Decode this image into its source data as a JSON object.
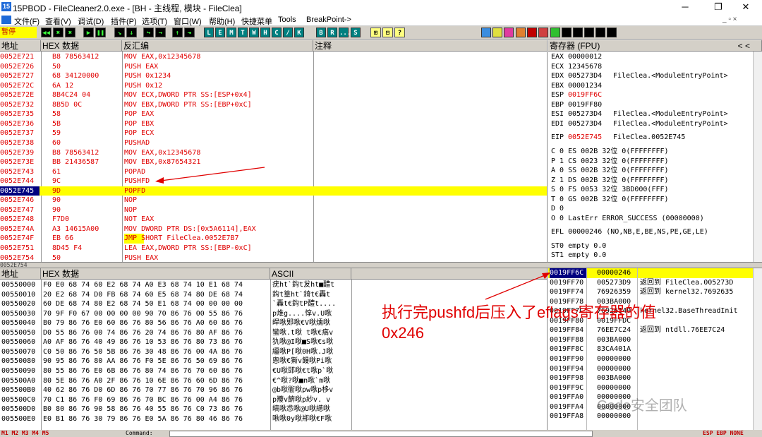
{
  "titlebar": {
    "app_icon_text": "15",
    "title": "15PBOD - FileCleaner2.0.exe - [BH - 主线程, 模块 - FileClea]",
    "minimize": "─",
    "maximize": "❐",
    "close": "✕"
  },
  "menubar": {
    "items": [
      "文件(F)",
      "查看(V)",
      "调试(D)",
      "插件(P)",
      "选项(T)",
      "窗口(W)",
      "帮助(H)",
      "快捷菜单",
      "Tools",
      "BreakPoint->"
    ],
    "mdi_controls": "_ ▫ ×"
  },
  "toolbar": {
    "state": "暂停",
    "debug_buttons": [
      "◀◀",
      "✖",
      "▶",
      "❚❚",
      "↘",
      "↓",
      "↪",
      "→",
      "↑",
      "⇥"
    ],
    "letter_buttons": [
      "L",
      "E",
      "M",
      "T",
      "W",
      "H",
      "C",
      "/",
      "K",
      "B",
      "R",
      "...",
      "S"
    ],
    "right_icons": [
      "⊞",
      "⊟",
      "?"
    ]
  },
  "disasm": {
    "headers": {
      "addr": "地址",
      "hex": "HEX 数据",
      "disasm": "反汇编",
      "comment": "注释"
    },
    "rows": [
      {
        "addr": "0052E721",
        "hex": "B8 78563412",
        "asm": "MOV EAX,0x12345678",
        "hl": false,
        "arrow": false
      },
      {
        "addr": "0052E726",
        "hex": "50",
        "asm": "PUSH EAX",
        "hl": false,
        "arrow": false
      },
      {
        "addr": "0052E727",
        "hex": "68 34120000",
        "asm": "PUSH 0x1234",
        "hl": false,
        "arrow": false
      },
      {
        "addr": "0052E72C",
        "hex": "6A 12",
        "asm": "PUSH 0x12",
        "hl": false,
        "arrow": false
      },
      {
        "addr": "0052E72E",
        "hex": "8B4C24 04",
        "asm": "MOV ECX,DWORD PTR SS:[ESP+0x4]",
        "hl": false,
        "arrow": false
      },
      {
        "addr": "0052E732",
        "hex": "8B5D 0C",
        "asm": "MOV EBX,DWORD PTR SS:[EBP+0xC]",
        "hl": false,
        "arrow": false
      },
      {
        "addr": "0052E735",
        "hex": "58",
        "asm": "POP EAX",
        "hl": false,
        "arrow": false
      },
      {
        "addr": "0052E736",
        "hex": "5B",
        "asm": "POP EBX",
        "hl": false,
        "arrow": false
      },
      {
        "addr": "0052E737",
        "hex": "59",
        "asm": "POP ECX",
        "hl": false,
        "arrow": false
      },
      {
        "addr": "0052E738",
        "hex": "60",
        "asm": "PUSHAD",
        "hl": false,
        "arrow": false
      },
      {
        "addr": "0052E739",
        "hex": "B8 78563412",
        "asm": "MOV EAX,0x12345678",
        "hl": false,
        "arrow": false
      },
      {
        "addr": "0052E73E",
        "hex": "BB 21436587",
        "asm": "MOV EBX,0x87654321",
        "hl": false,
        "arrow": false
      },
      {
        "addr": "0052E743",
        "hex": "61",
        "asm": "POPAD",
        "hl": false,
        "arrow": false
      },
      {
        "addr": "0052E744",
        "hex": "9C",
        "asm": "PUSHFD",
        "hl": false,
        "arrow": true
      },
      {
        "addr": "0052E745",
        "hex": "9D",
        "asm": "POPFD",
        "hl": true,
        "arrow": false
      },
      {
        "addr": "0052E746",
        "hex": "90",
        "asm": "NOP",
        "hl": false,
        "arrow": false
      },
      {
        "addr": "0052E747",
        "hex": "90",
        "asm": "NOP",
        "hl": false,
        "arrow": false
      },
      {
        "addr": "0052E748",
        "hex": "F7D0",
        "asm": "NOT EAX",
        "hl": false,
        "arrow": false
      },
      {
        "addr": "0052E74A",
        "hex": "A3 14615A00",
        "asm": "MOV DWORD PTR DS:[0x5A6114],EAX",
        "hl": false,
        "arrow": false
      },
      {
        "addr": "0052E74F",
        "hex": "EB 66",
        "asm": "JMP SHORT FileClea.0052E7B7",
        "hl": false,
        "arrow": false,
        "jmp": true
      },
      {
        "addr": "0052E751",
        "hex": "8D45 F4",
        "asm": "LEA EAX,DWORD PTR SS:[EBP-0xC]",
        "hl": false,
        "arrow": false
      },
      {
        "addr": "0052E754",
        "hex": "50",
        "asm": "PUSH EAX",
        "hl": false,
        "arrow": false
      }
    ]
  },
  "registers": {
    "header": "寄存器 (FPU)",
    "header_arrows": "<   <",
    "lines": [
      {
        "name": "EAX",
        "val": "00000012",
        "note": "",
        "red": false
      },
      {
        "name": "ECX",
        "val": "12345678",
        "note": "",
        "red": false
      },
      {
        "name": "EDX",
        "val": "005273D4",
        "note": "FileClea.<ModuleEntryPoint>",
        "red": false
      },
      {
        "name": "EBX",
        "val": "00001234",
        "note": "",
        "red": false
      },
      {
        "name": "ESP",
        "val": "0019FF6C",
        "note": "",
        "red": true
      },
      {
        "name": "EBP",
        "val": "0019FF80",
        "note": "",
        "red": false
      },
      {
        "name": "ESI",
        "val": "005273D4",
        "note": "FileClea.<ModuleEntryPoint>",
        "red": false
      },
      {
        "name": "EDI",
        "val": "005273D4",
        "note": "FileClea.<ModuleEntryPoint>",
        "red": false
      }
    ],
    "eip": {
      "name": "EIP",
      "val": "0052E745",
      "note": "FileClea.0052E745"
    },
    "flags": [
      "C 0  ES 002B 32位 0(FFFFFFFF)",
      "P 1  CS 0023 32位 0(FFFFFFFF)",
      "A 0  SS 002B 32位 0(FFFFFFFF)",
      "Z 1  DS 002B 32位 0(FFFFFFFF)",
      "S 0  FS 0053 32位 3BD000(FFF)",
      "T 0  GS 002B 32位 0(FFFFFFFF)",
      "D 0",
      "O 0  LastErr ERROR_SUCCESS (00000000)"
    ],
    "efl": "EFL 00000246 (NO,NB,E,BE,NS,PE,GE,LE)",
    "st": [
      "ST0 empty 0.0",
      "ST1 empty 0.0"
    ]
  },
  "dump": {
    "headers": {
      "addr": "地址",
      "hex": "HEX 数据",
      "ascii": "ASCII"
    },
    "rows": [
      {
        "addr": "00550000",
        "hex": "F0 E0 68 74 60 E2 68 74 A0 E3 68 74 10 E1 68 74",
        "ascii": "疣ht`鈎t犮ht■醴t"
      },
      {
        "addr": "00550010",
        "hex": "20 E2 68 74 D0 FB 68 74 60 E5 68 74 80 DE 68 74",
        "ascii": " 鈎t篁ht`錡t€轟t"
      },
      {
        "addr": "00550020",
        "hex": "60 DE 68 74 80 E2 68 74 50 E1 68 74 00 00 00 00",
        "ascii": "`轟t€鈎tP醴t...."
      },
      {
        "addr": "00550030",
        "hex": "70 9F F0 67 00 00 00 00 90 70 86 76 00 55 86 76",
        "ascii": "p焳g....惇v.U唙"
      },
      {
        "addr": "00550040",
        "hex": "B0 79 86 76 E0 60 86 76 80 56 86 76 A0 60 86 76",
        "ascii": "皔唙郹唙€V唙燻唙"
      },
      {
        "addr": "00550050",
        "hex": "D0 55 86 76 00 74 86 76 20 74 86 76 80 AF 86 76",
        "ascii": "蠻唙.t唙 t唙€瘑v"
      },
      {
        "addr": "00550060",
        "hex": "A0 AF 86 76 40 49 86 76 10 53 86 76 80 73 86 76",
        "ascii": "犰唙@I唙■S唙€s唙"
      },
      {
        "addr": "00550070",
        "hex": "C0 50 86 76 50 5B 86 76 30 48 86 76 00 4A 86 76",
        "ascii": "繮唙P[唙0H唙.J唙"
      },
      {
        "addr": "00550080",
        "hex": "90 95 86 76 80 AA 86 76 F0 5E 86 76 50 69 86 76",
        "ascii": "悤唙€獑v饅唙Pi唙"
      },
      {
        "addr": "00550090",
        "hex": "80 55 86 76 E0 6B 86 76 80 74 86 76 70 60 86 76",
        "ascii": "€U唙郖唙€t唙p`唙"
      },
      {
        "addr": "005500A0",
        "hex": "80 5E 86 76 A0 2F 86 76 10 6E 86 76 60 6D 86 76",
        "ascii": "€^唙?唙■n唙`m唙"
      },
      {
        "addr": "005500B0",
        "hex": "40 62 86 76 D0 6D 86 76 70 77 86 76 70 96 86 76",
        "ascii": "@b唙衜唙pw唙p栘v"
      },
      {
        "addr": "005500C0",
        "hex": "70 C1 86 76 F0 69 86 76 70 BC 86 76 00 A4 86 76",
        "ascii": "p羻v餴唙p紗v.  v"
      },
      {
        "addr": "005500D0",
        "hex": "B0 80 86 76 90 58 86 76 40 55 86 76 C0 73 86 76",
        "ascii": "皜唙怷唙@U唙繱唙"
      },
      {
        "addr": "005500E0",
        "hex": "E0 B1 86 76 30 79 86 76 E0 5A 86 76 80 46 86 76",
        "ascii": "啾唙0y唙郱唙€F唙"
      }
    ]
  },
  "stack": {
    "rows": [
      {
        "addr": "0019FF6C",
        "val": "00000246",
        "note": "",
        "hl": true
      },
      {
        "addr": "0019FF70",
        "val": "005273D9",
        "note": "返回到 FileClea.005273D",
        "hl": false
      },
      {
        "addr": "0019FF74",
        "val": "76926359",
        "note": "返回到 kernel32.7692635",
        "hl": false
      },
      {
        "addr": "0019FF78",
        "val": "003BA000",
        "note": "",
        "hl": false
      },
      {
        "addr": "0019FF7C",
        "val": "76926340",
        "note": "kernel32.BaseThreadInit",
        "hl": false
      },
      {
        "addr": "0019FF80",
        "val": "0019FFDC",
        "note": "",
        "hl": false
      },
      {
        "addr": "0019FF84",
        "val": "76EE7C24",
        "note": "返回到 ntdll.76EE7C24",
        "hl": false
      },
      {
        "addr": "0019FF88",
        "val": "003BA000",
        "note": "",
        "hl": false
      },
      {
        "addr": "0019FF8C",
        "val": "83CA401A",
        "note": "",
        "hl": false
      },
      {
        "addr": "0019FF90",
        "val": "00000000",
        "note": "",
        "hl": false
      },
      {
        "addr": "0019FF94",
        "val": "00000000",
        "note": "",
        "hl": false
      },
      {
        "addr": "0019FF98",
        "val": "003BA000",
        "note": "",
        "hl": false
      },
      {
        "addr": "0019FF9C",
        "val": "00000000",
        "note": "",
        "hl": false
      },
      {
        "addr": "0019FFA0",
        "val": "00000000",
        "note": "",
        "hl": false
      },
      {
        "addr": "0019FFA4",
        "val": "00000000",
        "note": "",
        "hl": false
      },
      {
        "addr": "0019FFA8",
        "val": "00000000",
        "note": "",
        "hl": false
      }
    ]
  },
  "annotation": {
    "line1": "执行完pushfd后压入了eflags寄存器的值",
    "line2": "0x246"
  },
  "watermark": "Code安全团队",
  "bottombar": {
    "tabs": "M1  M2  M3  M4  M5",
    "command_label": "Command:",
    "regs": "ESP  EBP  NONE"
  },
  "colors": {
    "accent_red": "#e00000",
    "highlight_yellow": "#ffff00",
    "selection_blue": "#000080"
  }
}
